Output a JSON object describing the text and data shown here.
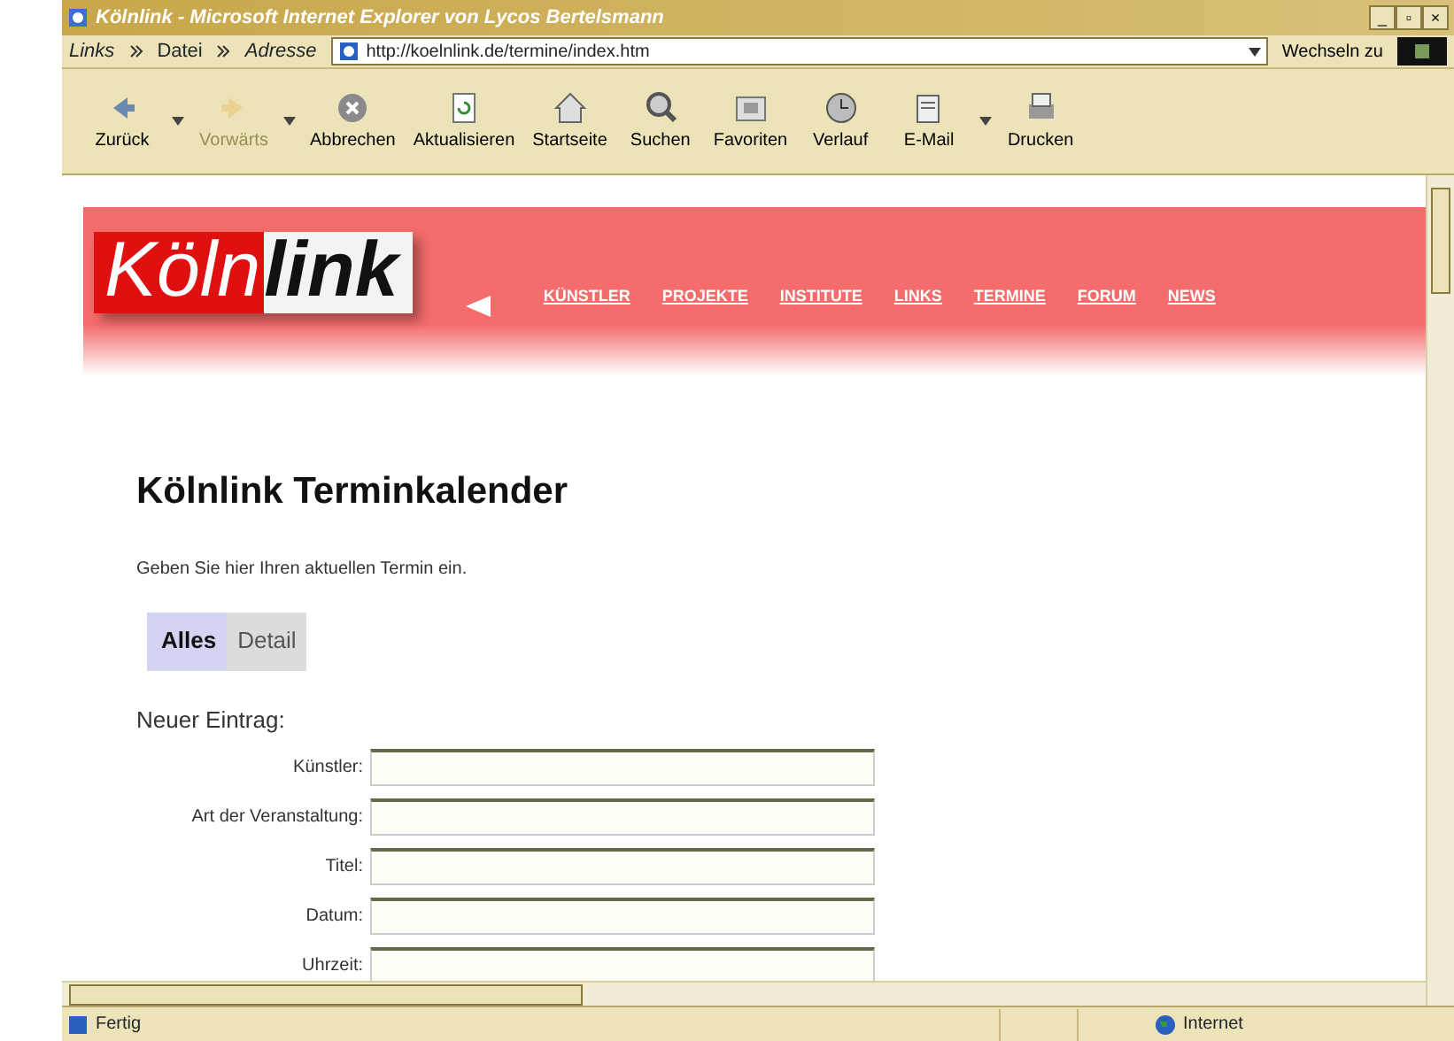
{
  "window": {
    "title": "Kölnlink - Microsoft Internet Explorer von Lycos Bertelsmann",
    "controls": [
      "_",
      "▫",
      "×"
    ]
  },
  "address_bar": {
    "links_label": "Links",
    "menu": "Datei",
    "address_label": "Adresse",
    "url": "http://koelnlink.de/termine/index.htm",
    "go_label": "Wechseln zu"
  },
  "toolbar": [
    {
      "label": "Zurück",
      "kind": "back",
      "disabled": false,
      "dropdown": true
    },
    {
      "label": "Vorwärts",
      "kind": "forward",
      "disabled": true,
      "dropdown": true
    },
    {
      "label": "Abbrechen",
      "kind": "stop",
      "disabled": false,
      "dropdown": false
    },
    {
      "label": "Aktualisieren",
      "kind": "refresh",
      "disabled": false,
      "dropdown": false
    },
    {
      "label": "Startseite",
      "kind": "home",
      "disabled": false,
      "dropdown": false
    },
    {
      "label": "Suchen",
      "kind": "search",
      "disabled": false,
      "dropdown": false
    },
    {
      "label": "Favoriten",
      "kind": "favorites",
      "disabled": false,
      "dropdown": false
    },
    {
      "label": "Verlauf",
      "kind": "history",
      "disabled": false,
      "dropdown": false
    },
    {
      "label": "E-Mail",
      "kind": "mail",
      "disabled": false,
      "dropdown": true
    },
    {
      "label": "Drucken",
      "kind": "print",
      "disabled": false,
      "dropdown": false
    }
  ],
  "page": {
    "logo": {
      "part_1": "Köln",
      "part_2": "link"
    },
    "nav": [
      "KÜNSTLER",
      "PROJEKTE",
      "INSTITUTE",
      "LINKS",
      "TERMINE",
      "FORUM",
      "NEWS"
    ],
    "heading": "Kölnlink Terminkalender",
    "intro": "Geben Sie hier Ihren aktuellen Termin ein.",
    "tabs": [
      {
        "label": "Alles",
        "selected": true
      },
      {
        "label": "Detail",
        "selected": false
      }
    ],
    "form_title": "Neuer Eintrag:",
    "fields": [
      {
        "label": "Künstler:"
      },
      {
        "label": "Art der Veranstaltung:"
      },
      {
        "label": "Titel:"
      },
      {
        "label": "Datum:"
      },
      {
        "label": "Uhrzeit:"
      }
    ]
  },
  "status_bar": {
    "status": "Fertig",
    "zone": "Internet"
  }
}
